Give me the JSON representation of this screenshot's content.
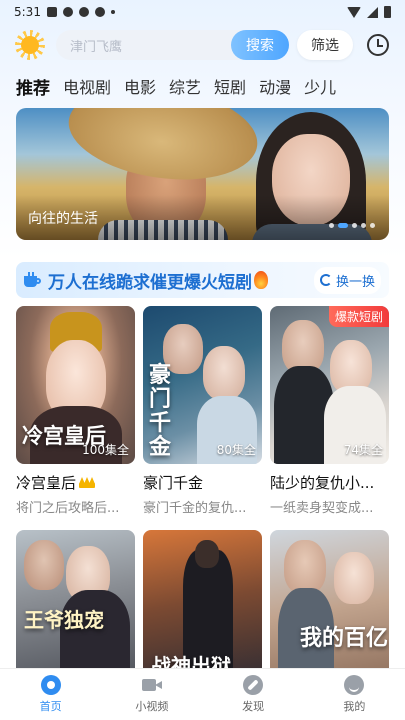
{
  "status_bar": {
    "time": "5:31"
  },
  "search": {
    "placeholder": "津门飞鹰",
    "button_label": "搜索",
    "filter_label": "筛选"
  },
  "categories": [
    {
      "label": "推荐",
      "active": true
    },
    {
      "label": "电视剧"
    },
    {
      "label": "电影"
    },
    {
      "label": "综艺"
    },
    {
      "label": "短剧"
    },
    {
      "label": "动漫"
    },
    {
      "label": "少儿"
    }
  ],
  "banner": {
    "title": "向往的生活",
    "slide_count": 5,
    "active_slide": 1
  },
  "section": {
    "title": "万人在线跪求催更爆火短剧",
    "refresh_label": "换一换"
  },
  "dramas": [
    {
      "title": "冷宫皇后",
      "subtitle": "将门之后攻略后...",
      "episodes": "100集全",
      "poster_text": "冷宫皇后",
      "has_crown": true
    },
    {
      "title": "豪门千金",
      "subtitle": "豪门千金的复仇...",
      "episodes": "80集全",
      "poster_text": "豪门千金"
    },
    {
      "title": "陆少的复仇小...",
      "subtitle": "一纸卖身契变成...",
      "episodes": "74集全",
      "badge": "爆款短剧"
    },
    {
      "poster_text": "王爷独宠"
    },
    {
      "poster_text": "战神出狱"
    },
    {
      "poster_text": "我的百亿"
    }
  ],
  "bottom_nav": [
    {
      "label": "首页",
      "active": true
    },
    {
      "label": "小视频"
    },
    {
      "label": "发现"
    },
    {
      "label": "我的"
    }
  ]
}
